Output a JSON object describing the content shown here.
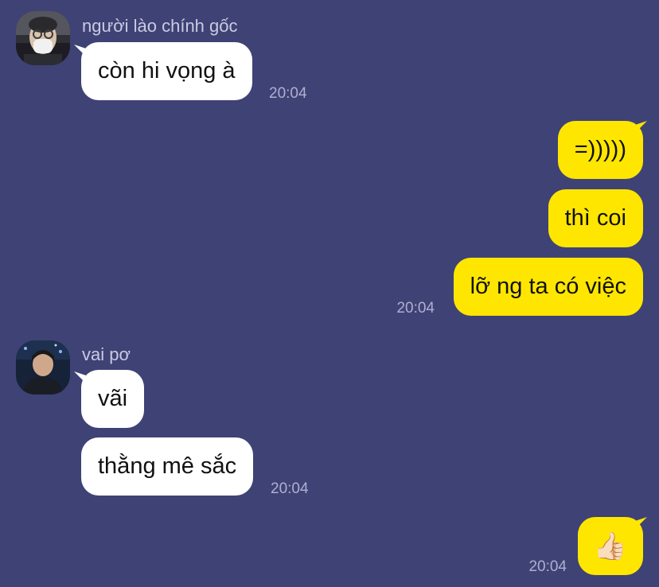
{
  "colors": {
    "background": "#3f4275",
    "incoming_bubble": "#ffffff",
    "outgoing_bubble": "#ffe600",
    "text": "#111111",
    "name_text": "#c9cbe3",
    "timestamp": "#aeb0cf"
  },
  "messages": {
    "group1": {
      "sender": "người lào chính gốc",
      "avatar_icon": "masked-person-avatar",
      "bubbles": [
        "còn hi vọng à"
      ],
      "time": "20:04"
    },
    "group2": {
      "sender": "me",
      "bubbles": [
        "=)))))",
        "thì coi",
        "lỡ ng ta có việc"
      ],
      "time": "20:04"
    },
    "group3": {
      "sender": "vai pơ",
      "avatar_icon": "young-man-avatar",
      "bubbles": [
        "vãi",
        "thằng mê sắc"
      ],
      "time": "20:04"
    },
    "group4": {
      "sender": "me",
      "bubbles": [
        "👍🏻"
      ],
      "time": "20:04"
    }
  }
}
